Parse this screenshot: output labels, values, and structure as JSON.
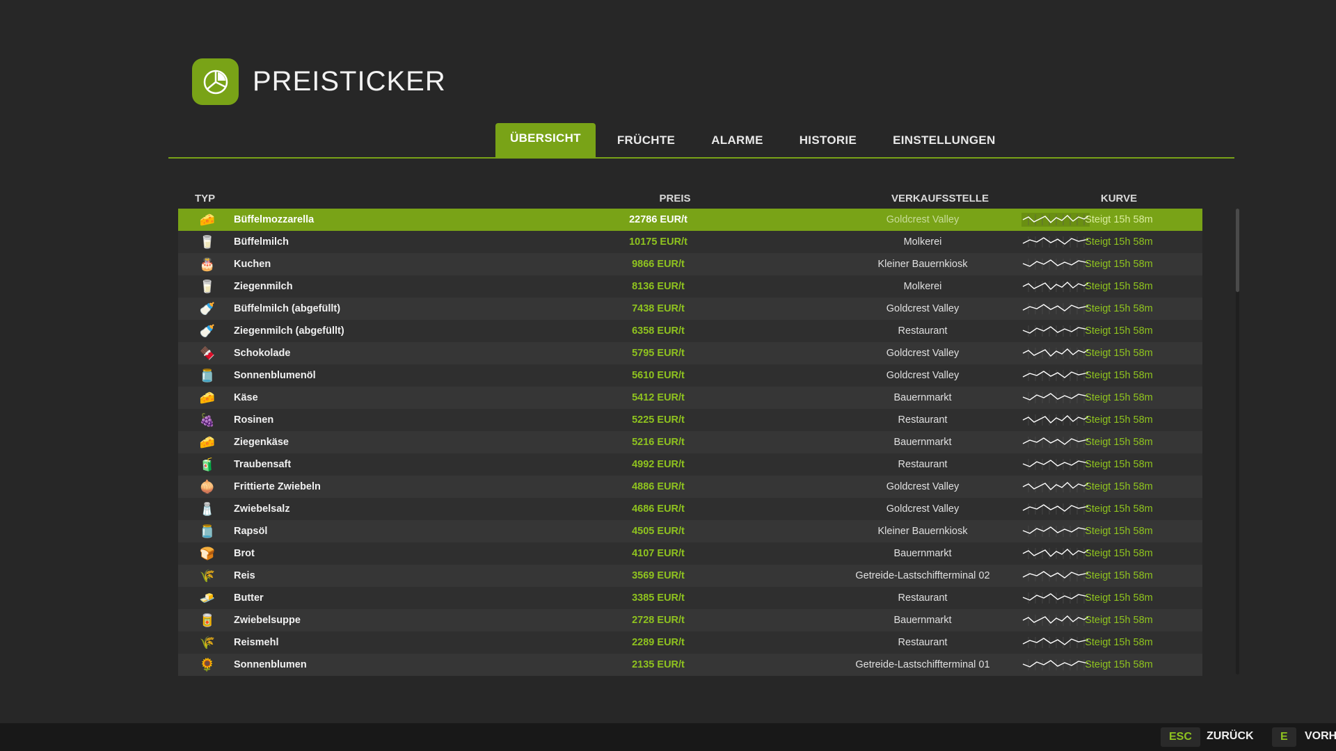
{
  "header": {
    "title": "PREISTICKER",
    "logo_icon": "pie-chart-icon"
  },
  "tabs": [
    {
      "label": "ÜBERSICHT",
      "active": true
    },
    {
      "label": "FRÜCHTE",
      "active": false
    },
    {
      "label": "ALARME",
      "active": false
    },
    {
      "label": "HISTORIE",
      "active": false
    },
    {
      "label": "EINSTELLUNGEN",
      "active": false
    }
  ],
  "table": {
    "columns": {
      "typ": "TYP",
      "preis": "PREIS",
      "verkaufsstelle": "VERKAUFSSTELLE",
      "kurve": "KURVE"
    },
    "rows": [
      {
        "name": "Büffelmozzarella",
        "price": "22786 EUR/t",
        "seller": "Goldcrest Valley",
        "trend": "Steigt 15h 58m",
        "icon": "🧀",
        "selected": true
      },
      {
        "name": "Büffelmilch",
        "price": "10175 EUR/t",
        "seller": "Molkerei",
        "trend": "Steigt 15h 58m",
        "icon": "🥛"
      },
      {
        "name": "Kuchen",
        "price": "9866 EUR/t",
        "seller": "Kleiner Bauernkiosk",
        "trend": "Steigt 15h 58m",
        "icon": "🎂"
      },
      {
        "name": "Ziegenmilch",
        "price": "8136 EUR/t",
        "seller": "Molkerei",
        "trend": "Steigt 15h 58m",
        "icon": "🥛"
      },
      {
        "name": "Büffelmilch (abgefüllt)",
        "price": "7438 EUR/t",
        "seller": "Goldcrest Valley",
        "trend": "Steigt 15h 58m",
        "icon": "🍼"
      },
      {
        "name": "Ziegenmilch (abgefüllt)",
        "price": "6358 EUR/t",
        "seller": "Restaurant",
        "trend": "Steigt 15h 58m",
        "icon": "🍼"
      },
      {
        "name": "Schokolade",
        "price": "5795 EUR/t",
        "seller": "Goldcrest Valley",
        "trend": "Steigt 15h 58m",
        "icon": "🍫"
      },
      {
        "name": "Sonnenblumenöl",
        "price": "5610 EUR/t",
        "seller": "Goldcrest Valley",
        "trend": "Steigt 15h 58m",
        "icon": "🫙"
      },
      {
        "name": "Käse",
        "price": "5412 EUR/t",
        "seller": "Bauernmarkt",
        "trend": "Steigt 15h 58m",
        "icon": "🧀"
      },
      {
        "name": "Rosinen",
        "price": "5225 EUR/t",
        "seller": "Restaurant",
        "trend": "Steigt 15h 58m",
        "icon": "🍇"
      },
      {
        "name": "Ziegenkäse",
        "price": "5216 EUR/t",
        "seller": "Bauernmarkt",
        "trend": "Steigt 15h 58m",
        "icon": "🧀"
      },
      {
        "name": "Traubensaft",
        "price": "4992 EUR/t",
        "seller": "Restaurant",
        "trend": "Steigt 15h 58m",
        "icon": "🧃"
      },
      {
        "name": "Frittierte Zwiebeln",
        "price": "4886 EUR/t",
        "seller": "Goldcrest Valley",
        "trend": "Steigt 15h 58m",
        "icon": "🧅"
      },
      {
        "name": "Zwiebelsalz",
        "price": "4686 EUR/t",
        "seller": "Goldcrest Valley",
        "trend": "Steigt 15h 58m",
        "icon": "🧂"
      },
      {
        "name": "Rapsöl",
        "price": "4505 EUR/t",
        "seller": "Kleiner Bauernkiosk",
        "trend": "Steigt 15h 58m",
        "icon": "🫙"
      },
      {
        "name": "Brot",
        "price": "4107 EUR/t",
        "seller": "Bauernmarkt",
        "trend": "Steigt 15h 58m",
        "icon": "🍞"
      },
      {
        "name": "Reis",
        "price": "3569 EUR/t",
        "seller": "Getreide-Lastschiffterminal 02",
        "trend": "Steigt 15h 58m",
        "icon": "🌾"
      },
      {
        "name": "Butter",
        "price": "3385 EUR/t",
        "seller": "Restaurant",
        "trend": "Steigt 15h 58m",
        "icon": "🧈"
      },
      {
        "name": "Zwiebelsuppe",
        "price": "2728 EUR/t",
        "seller": "Bauernmarkt",
        "trend": "Steigt 15h 58m",
        "icon": "🥫"
      },
      {
        "name": "Reismehl",
        "price": "2289 EUR/t",
        "seller": "Restaurant",
        "trend": "Steigt 15h 58m",
        "icon": "🌾"
      },
      {
        "name": "Sonnenblumen",
        "price": "2135 EUR/t",
        "seller": "Getreide-Lastschiffterminal 01",
        "trend": "Steigt 15h 58m",
        "icon": "🌻"
      }
    ]
  },
  "bottombar": {
    "back_key": "ESC",
    "back_label": "ZURÜCK",
    "next_key": "E",
    "next_label": "VORH"
  },
  "colors": {
    "accent": "#79a317",
    "price": "#8fc31f",
    "background": "#272727"
  }
}
